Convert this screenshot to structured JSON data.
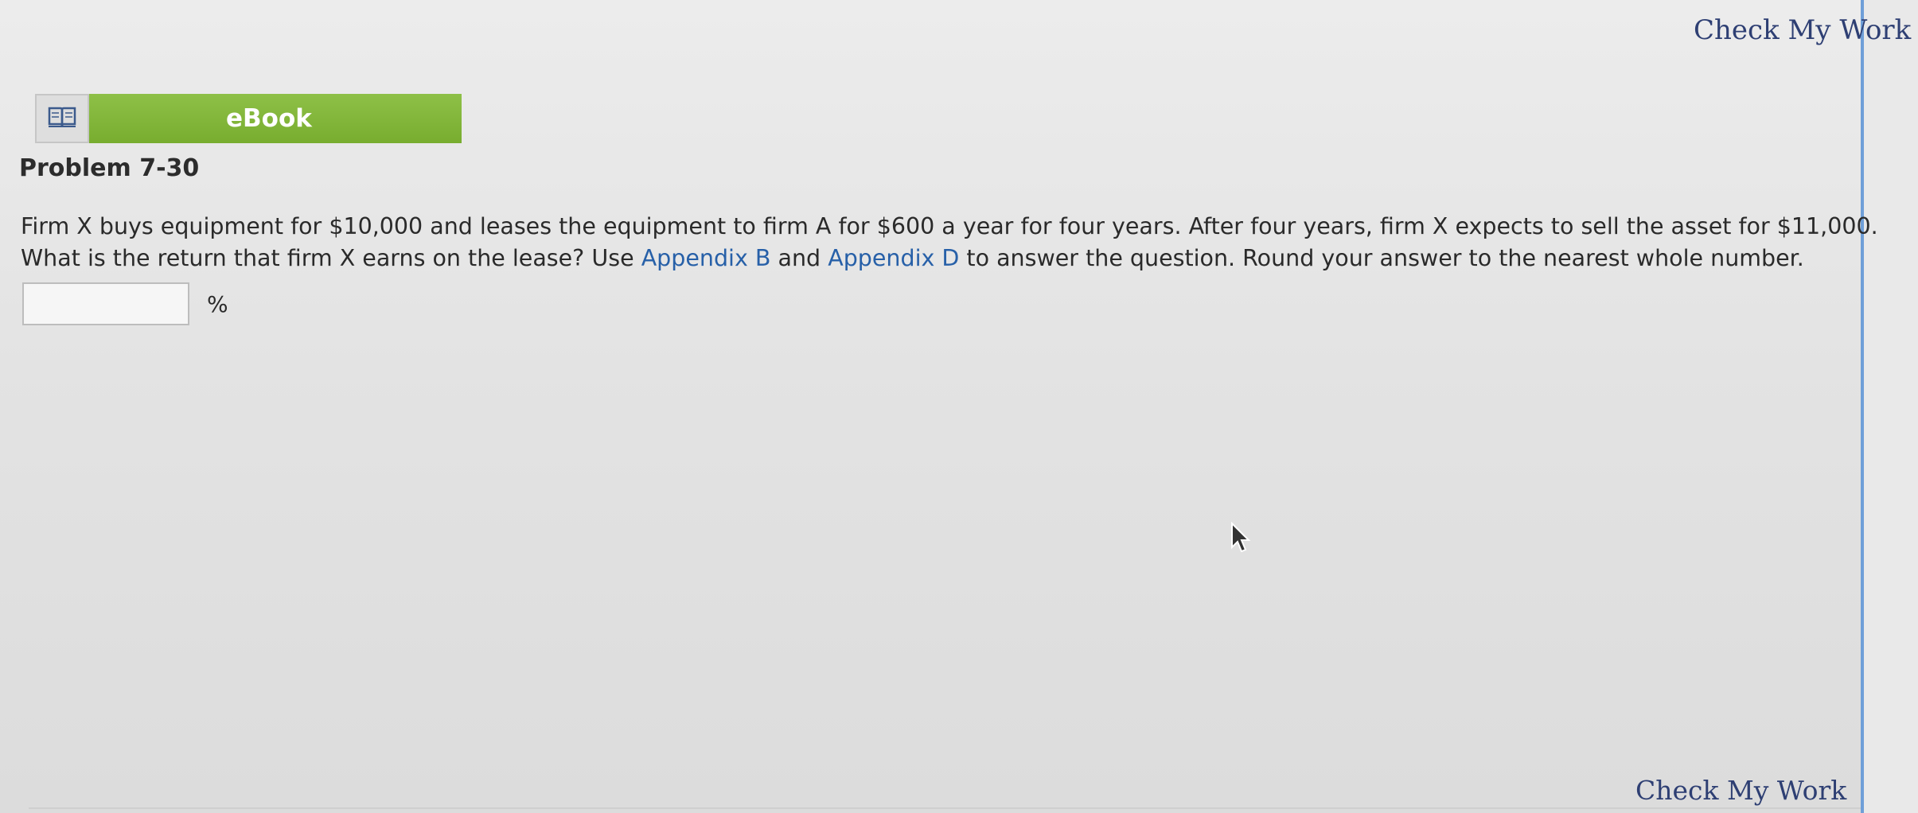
{
  "header": {
    "check_my_work_top": "Check My Work"
  },
  "ebook": {
    "icon": "open-book-icon",
    "label": "eBook"
  },
  "problem": {
    "title": "Problem 7-30",
    "line1": "Firm X buys equipment for $10,000 and leases the equipment to firm A for $600 a year for four years. After four years, firm X expects to sell the asset for $11,000.",
    "line2_prefix": "What is the return that firm X earns on the lease? Use ",
    "link_b": "Appendix B",
    "line2_mid": " and ",
    "link_d": "Appendix D",
    "line2_suffix": " to answer the question. Round your answer to the nearest whole number."
  },
  "answer": {
    "value": "",
    "unit": "%"
  },
  "footer": {
    "check_my_work_bottom": "Check My Work"
  },
  "colors": {
    "link": "#2760a8",
    "check_my_work": "#2e3f73",
    "ebook_green": "#82b63a",
    "right_rule": "#6f9fd8"
  }
}
